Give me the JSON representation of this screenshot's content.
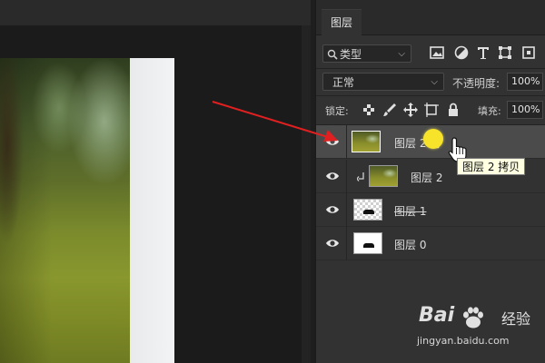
{
  "panel": {
    "tab_label": "图层",
    "filter": {
      "label": "类型",
      "icons": [
        "image-icon",
        "adjustment-icon",
        "type-icon",
        "shape-icon",
        "smart-object-icon"
      ]
    },
    "blend_mode": "正常",
    "opacity_label": "不透明度:",
    "opacity_value": "100%",
    "lock_label": "锁定:",
    "lock_icons": [
      "lock-transparency-icon",
      "lock-paint-icon",
      "lock-move-icon",
      "lock-artboard-icon",
      "lock-all-icon"
    ],
    "fill_label": "填充:",
    "fill_value": "100%"
  },
  "layers": [
    {
      "name": "图层 2 拷",
      "visible": true,
      "selected": true,
      "thumb": "photo"
    },
    {
      "name": "图层 2",
      "visible": true,
      "selected": false,
      "thumb": "photo",
      "clipped": true
    },
    {
      "name": "图层 1",
      "visible": true,
      "selected": false,
      "thumb": "checker"
    },
    {
      "name": "图层 0",
      "visible": true,
      "selected": false,
      "thumb": "white"
    }
  ],
  "tooltip": "图层 2 拷贝",
  "watermark": {
    "brand": "Bai",
    "brand_tail": "经验",
    "url": "jingyan.baidu.com"
  },
  "colors": {
    "panel": "#323232",
    "selected": "#4b4b4b",
    "arrow": "#e02020",
    "highlight": "#f6e32a"
  }
}
